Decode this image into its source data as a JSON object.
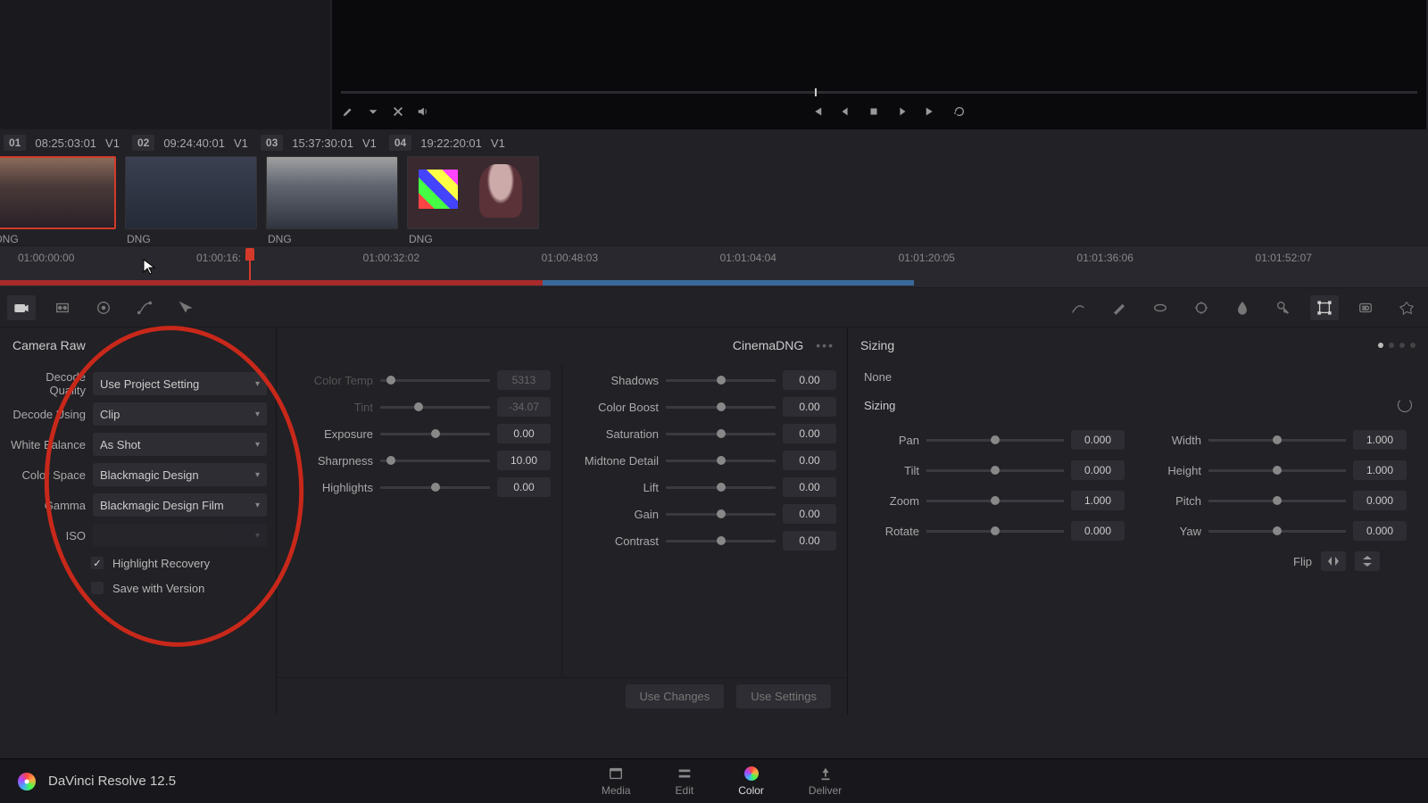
{
  "app": {
    "title": "DaVinci Resolve 12.5"
  },
  "clips": {
    "meta": [
      {
        "num": "01",
        "tc": "08:25:03:01",
        "track": "V1"
      },
      {
        "num": "02",
        "tc": "09:24:40:01",
        "track": "V1"
      },
      {
        "num": "03",
        "tc": "15:37:30:01",
        "track": "V1"
      },
      {
        "num": "04",
        "tc": "19:22:20:01",
        "track": "V1"
      }
    ],
    "labels": [
      "DNG",
      "DNG",
      "DNG",
      "DNG"
    ]
  },
  "ruler": {
    "marks": [
      "01:00:00:00",
      "01:00:16:",
      "01:00:32:02",
      "01:00:48:03",
      "01:01:04:04",
      "01:01:20:05",
      "01:01:36:06",
      "01:01:52:07"
    ]
  },
  "camera_raw": {
    "title": "Camera Raw",
    "format": "CinemaDNG",
    "rows": {
      "decode_quality": {
        "label": "Decode Quality",
        "value": "Use Project Setting"
      },
      "decode_using": {
        "label": "Decode Using",
        "value": "Clip"
      },
      "white_balance": {
        "label": "White Balance",
        "value": "As Shot"
      },
      "color_space": {
        "label": "Color Space",
        "value": "Blackmagic Design"
      },
      "gamma": {
        "label": "Gamma",
        "value": "Blackmagic Design Film"
      },
      "iso": {
        "label": "ISO",
        "value": ""
      }
    },
    "highlight_recovery": "Highlight Recovery",
    "save_with_version": "Save with Version"
  },
  "mid": {
    "col1": [
      {
        "label": "Color Temp",
        "value": "5313",
        "dim": true,
        "pos": 10
      },
      {
        "label": "Tint",
        "value": "-34.07",
        "dim": true,
        "pos": 35
      },
      {
        "label": "Exposure",
        "value": "0.00",
        "pos": 50
      },
      {
        "label": "Sharpness",
        "value": "10.00",
        "pos": 10
      },
      {
        "label": "Highlights",
        "value": "0.00",
        "pos": 50
      }
    ],
    "col2": [
      {
        "label": "Shadows",
        "value": "0.00",
        "pos": 50
      },
      {
        "label": "Color Boost",
        "value": "0.00",
        "pos": 50
      },
      {
        "label": "Saturation",
        "value": "0.00",
        "pos": 50
      },
      {
        "label": "Midtone Detail",
        "value": "0.00",
        "pos": 50
      },
      {
        "label": "Lift",
        "value": "0.00",
        "pos": 50
      },
      {
        "label": "Gain",
        "value": "0.00",
        "pos": 50
      },
      {
        "label": "Contrast",
        "value": "0.00",
        "pos": 50
      }
    ],
    "use_changes": "Use Changes",
    "use_settings": "Use Settings"
  },
  "sizing": {
    "title": "Sizing",
    "none": "None",
    "sub": "Sizing",
    "left": [
      {
        "label": "Pan",
        "value": "0.000"
      },
      {
        "label": "Tilt",
        "value": "0.000"
      },
      {
        "label": "Zoom",
        "value": "1.000"
      },
      {
        "label": "Rotate",
        "value": "0.000"
      }
    ],
    "right": [
      {
        "label": "Width",
        "value": "1.000"
      },
      {
        "label": "Height",
        "value": "1.000"
      },
      {
        "label": "Pitch",
        "value": "0.000"
      },
      {
        "label": "Yaw",
        "value": "0.000"
      }
    ],
    "flip": "Flip"
  },
  "bottom_tabs": {
    "media": "Media",
    "edit": "Edit",
    "color": "Color",
    "deliver": "Deliver"
  }
}
